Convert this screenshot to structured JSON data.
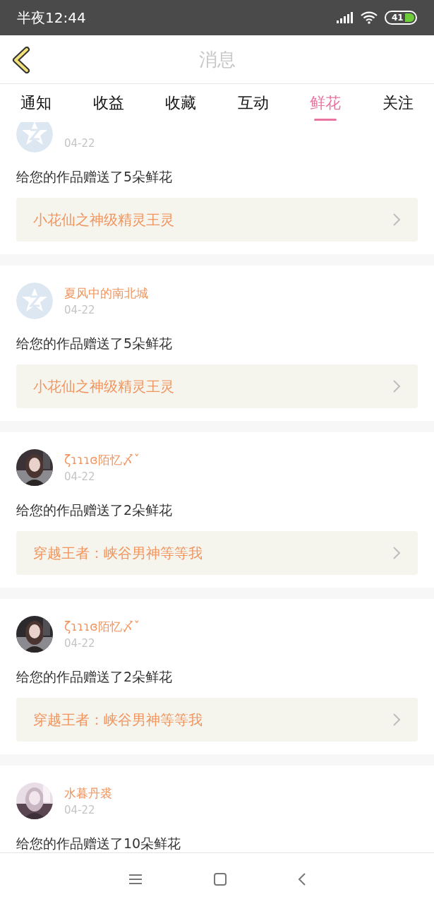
{
  "status_bar": {
    "time": "半夜12:44",
    "battery": "41"
  },
  "header": {
    "title": "消息"
  },
  "tabs": [
    {
      "label": "通知",
      "selected": false
    },
    {
      "label": "收益",
      "selected": false
    },
    {
      "label": "收藏",
      "selected": false
    },
    {
      "label": "互动",
      "selected": false
    },
    {
      "label": "鲜花",
      "selected": true
    },
    {
      "label": "关注",
      "selected": false
    }
  ],
  "notifications": [
    {
      "kind": "default",
      "date": "04-22",
      "message": "给您的作品赠送了5朵鲜花",
      "work": "小花仙之神级精灵王灵"
    },
    {
      "kind": "default",
      "name": "夏风中的南北城",
      "date": "04-22",
      "message": "给您的作品赠送了5朵鲜花",
      "work": "小花仙之神级精灵王灵"
    },
    {
      "kind": "picture",
      "name": "ζɿɿɿɞ陌忆〆ˇ",
      "date": "04-22",
      "message": "给您的作品赠送了2朵鲜花",
      "work": "穿越王者：峡谷男神等等我"
    },
    {
      "kind": "picture",
      "name": "ζɿɿɿɞ陌忆〆ˇ",
      "date": "04-22",
      "message": "给您的作品赠送了2朵鲜花",
      "work": "穿越王者：峡谷男神等等我"
    },
    {
      "kind": "picture",
      "name": "水暮丹裘",
      "date": "04-22",
      "message": "给您的作品赠送了10朵鲜花"
    }
  ]
}
